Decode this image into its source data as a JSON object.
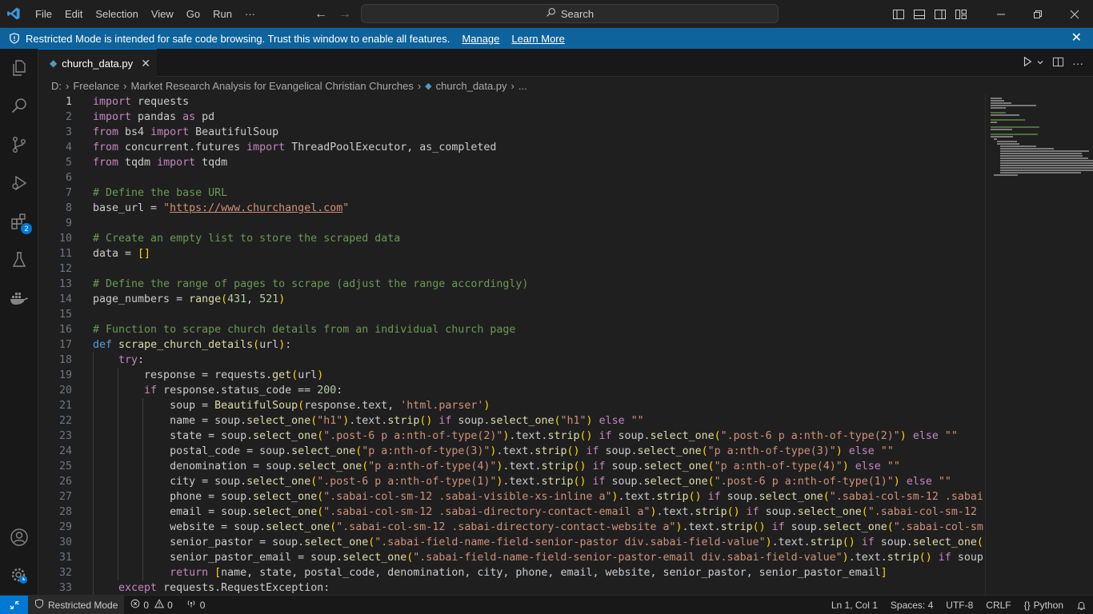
{
  "menu": {
    "items": [
      "File",
      "Edit",
      "Selection",
      "View",
      "Go",
      "Run",
      "···"
    ]
  },
  "search": {
    "label": "Search"
  },
  "banner": {
    "message": "Restricted Mode is intended for safe code browsing. Trust this window to enable all features.",
    "manage": "Manage",
    "learn_more": "Learn More"
  },
  "activity": {
    "extensions_badge": "2"
  },
  "tab": {
    "filename": "church_data.py"
  },
  "breadcrumb": {
    "items": [
      "D:",
      "Freelance",
      "Market Research Analysis for Evangelical Christian Churches",
      "church_data.py",
      "..."
    ]
  },
  "editor": {
    "lines": [
      {
        "n": "1",
        "indent": 0,
        "html": "<span class=\"kw\">import</span> requests"
      },
      {
        "n": "2",
        "indent": 0,
        "html": "<span class=\"kw\">import</span> pandas <span class=\"kw\">as</span> pd"
      },
      {
        "n": "3",
        "indent": 0,
        "html": "<span class=\"kw\">from</span> bs4 <span class=\"kw\">import</span> BeautifulSoup"
      },
      {
        "n": "4",
        "indent": 0,
        "html": "<span class=\"kw\">from</span> concurrent.futures <span class=\"kw\">import</span> ThreadPoolExecutor, as_completed"
      },
      {
        "n": "5",
        "indent": 0,
        "html": "<span class=\"kw\">from</span> tqdm <span class=\"kw\">import</span> tqdm"
      },
      {
        "n": "6",
        "indent": 0,
        "html": ""
      },
      {
        "n": "7",
        "indent": 0,
        "html": "<span class=\"cm\"># Define the base URL</span>"
      },
      {
        "n": "8",
        "indent": 0,
        "html": "base_url = <span class=\"str\">\"</span><span class=\"lnk\">https://www.churchangel.com</span><span class=\"str\">\"</span>"
      },
      {
        "n": "9",
        "indent": 0,
        "html": ""
      },
      {
        "n": "10",
        "indent": 0,
        "html": "<span class=\"cm\"># Create an empty list to store the scraped data</span>"
      },
      {
        "n": "11",
        "indent": 0,
        "html": "data = <span class=\"br1\">[]</span>"
      },
      {
        "n": "12",
        "indent": 0,
        "html": ""
      },
      {
        "n": "13",
        "indent": 0,
        "html": "<span class=\"cm\"># Define the range of pages to scrape (adjust the range accordingly)</span>"
      },
      {
        "n": "14",
        "indent": 0,
        "html": "page_numbers = <span class=\"fn\">range</span><span class=\"br1\">(</span><span class=\"num\">431</span>, <span class=\"num\">521</span><span class=\"br1\">)</span>"
      },
      {
        "n": "15",
        "indent": 0,
        "html": ""
      },
      {
        "n": "16",
        "indent": 0,
        "html": "<span class=\"cm\"># Function to scrape church details from an individual church page</span>"
      },
      {
        "n": "17",
        "indent": 0,
        "html": "<span class=\"kw2\">def</span> <span class=\"fn\">scrape_church_details</span><span class=\"br1\">(</span>url<span class=\"br1\">)</span>:"
      },
      {
        "n": "18",
        "indent": 1,
        "html": "    <span class=\"kw\">try</span>:"
      },
      {
        "n": "19",
        "indent": 2,
        "html": "        response = requests.<span class=\"fn\">get</span><span class=\"br1\">(</span>url<span class=\"br1\">)</span>"
      },
      {
        "n": "20",
        "indent": 2,
        "html": "        <span class=\"kw\">if</span> response.status_code == <span class=\"num\">200</span>:"
      },
      {
        "n": "21",
        "indent": 3,
        "html": "            soup = <span class=\"fn\">BeautifulSoup</span><span class=\"br1\">(</span>response.text, <span class=\"str\">'html.parser'</span><span class=\"br1\">)</span>"
      },
      {
        "n": "22",
        "indent": 3,
        "html": "            name = soup.<span class=\"fn\">select_one</span><span class=\"br1\">(</span><span class=\"str\">\"h1\"</span><span class=\"br1\">)</span>.text.<span class=\"fn\">strip</span><span class=\"br1\">()</span> <span class=\"kw\">if</span> soup.<span class=\"fn\">select_one</span><span class=\"br1\">(</span><span class=\"str\">\"h1\"</span><span class=\"br1\">)</span> <span class=\"kw\">else</span> <span class=\"str\">\"\"</span>"
      },
      {
        "n": "23",
        "indent": 3,
        "html": "            state = soup.<span class=\"fn\">select_one</span><span class=\"br1\">(</span><span class=\"str\">\".post-6 p a:nth-of-type(2)\"</span><span class=\"br1\">)</span>.text.<span class=\"fn\">strip</span><span class=\"br1\">()</span> <span class=\"kw\">if</span> soup.<span class=\"fn\">select_one</span><span class=\"br1\">(</span><span class=\"str\">\".post-6 p a:nth-of-type(2)\"</span><span class=\"br1\">)</span> <span class=\"kw\">else</span> <span class=\"str\">\"\"</span>"
      },
      {
        "n": "24",
        "indent": 3,
        "html": "            postal_code = soup.<span class=\"fn\">select_one</span><span class=\"br1\">(</span><span class=\"str\">\"p a:nth-of-type(3)\"</span><span class=\"br1\">)</span>.text.<span class=\"fn\">strip</span><span class=\"br1\">()</span> <span class=\"kw\">if</span> soup.<span class=\"fn\">select_one</span><span class=\"br1\">(</span><span class=\"str\">\"p a:nth-of-type(3)\"</span><span class=\"br1\">)</span> <span class=\"kw\">else</span> <span class=\"str\">\"\"</span>"
      },
      {
        "n": "25",
        "indent": 3,
        "html": "            denomination = soup.<span class=\"fn\">select_one</span><span class=\"br1\">(</span><span class=\"str\">\"p a:nth-of-type(4)\"</span><span class=\"br1\">)</span>.text.<span class=\"fn\">strip</span><span class=\"br1\">()</span> <span class=\"kw\">if</span> soup.<span class=\"fn\">select_one</span><span class=\"br1\">(</span><span class=\"str\">\"p a:nth-of-type(4)\"</span><span class=\"br1\">)</span> <span class=\"kw\">else</span> <span class=\"str\">\"\"</span>"
      },
      {
        "n": "26",
        "indent": 3,
        "html": "            city = soup.<span class=\"fn\">select_one</span><span class=\"br1\">(</span><span class=\"str\">\".post-6 p a:nth-of-type(1)\"</span><span class=\"br1\">)</span>.text.<span class=\"fn\">strip</span><span class=\"br1\">()</span> <span class=\"kw\">if</span> soup.<span class=\"fn\">select_one</span><span class=\"br1\">(</span><span class=\"str\">\".post-6 p a:nth-of-type(1)\"</span><span class=\"br1\">)</span> <span class=\"kw\">else</span> <span class=\"str\">\"\"</span>"
      },
      {
        "n": "27",
        "indent": 3,
        "html": "            phone = soup.<span class=\"fn\">select_one</span><span class=\"br1\">(</span><span class=\"str\">\".sabai-col-sm-12 .sabai-visible-xs-inline a\"</span><span class=\"br1\">)</span>.text.<span class=\"fn\">strip</span><span class=\"br1\">()</span> <span class=\"kw\">if</span> soup.<span class=\"fn\">select_one</span><span class=\"br1\">(</span><span class=\"str\">\".sabai-col-sm-12 .sabai-visible-xs-inline a\"</span><span class=\"br1\">)</span> <span class=\"kw\">else</span> <span class=\"str\">\"\"</span>"
      },
      {
        "n": "28",
        "indent": 3,
        "html": "            email = soup.<span class=\"fn\">select_one</span><span class=\"br1\">(</span><span class=\"str\">\".sabai-col-sm-12 .sabai-directory-contact-email a\"</span><span class=\"br1\">)</span>.text.<span class=\"fn\">strip</span><span class=\"br1\">()</span> <span class=\"kw\">if</span> soup.<span class=\"fn\">select_one</span><span class=\"br1\">(</span><span class=\"str\">\".sabai-col-sm-12 .sabai-directory-contact-email a\"</span><span class=\"br1\">)</span> <span class=\"kw\">else</span> <span class=\"str\">\"\"</span>"
      },
      {
        "n": "29",
        "indent": 3,
        "html": "            website = soup.<span class=\"fn\">select_one</span><span class=\"br1\">(</span><span class=\"str\">\".sabai-col-sm-12 .sabai-directory-contact-website a\"</span><span class=\"br1\">)</span>.text.<span class=\"fn\">strip</span><span class=\"br1\">()</span> <span class=\"kw\">if</span> soup.<span class=\"fn\">select_one</span><span class=\"br1\">(</span><span class=\"str\">\".sabai-col-sm-12 .sabai-directory-contact-website a\"</span><span class=\"br1\">)</span> <span class=\"kw\">else</span> <span class=\"str\">\"\"</span>"
      },
      {
        "n": "30",
        "indent": 3,
        "html": "            senior_pastor = soup.<span class=\"fn\">select_one</span><span class=\"br1\">(</span><span class=\"str\">\".sabai-field-name-field-senior-pastor div.sabai-field-value\"</span><span class=\"br1\">)</span>.text.<span class=\"fn\">strip</span><span class=\"br1\">()</span> <span class=\"kw\">if</span> soup.<span class=\"fn\">select_one</span><span class=\"br1\">(</span><span class=\"str\">\".sabai-field-name-field-senior-pastor div.sabai-field-value\"</span><span class=\"br1\">)</span> <span class=\"kw\">else</span> <span class=\"str\">\"\"</span>"
      },
      {
        "n": "31",
        "indent": 3,
        "html": "            senior_pastor_email = soup.<span class=\"fn\">select_one</span><span class=\"br1\">(</span><span class=\"str\">\".sabai-field-name-field-senior-pastor-email div.sabai-field-value\"</span><span class=\"br1\">)</span>.text.<span class=\"fn\">strip</span><span class=\"br1\">()</span> <span class=\"kw\">if</span> soup.<span class=\"fn\">select_one</span><span class=\"br1\">(</span><span class=\"str\">\".sabai-field-name-field-senior-pastor-email div.sabai-field-value\"</span><span class=\"br1\">)</span> <span class=\"kw\">else</span> <span class=\"str\">\"\"</span>"
      },
      {
        "n": "32",
        "indent": 3,
        "html": "            <span class=\"kw\">return</span> <span class=\"br1\">[</span>name, state, postal_code, denomination, city, phone, email, website, senior_pastor, senior_pastor_email<span class=\"br1\">]</span>"
      },
      {
        "n": "33",
        "indent": 1,
        "html": "    <span class=\"kw\">except</span> requests.RequestException:"
      }
    ]
  },
  "status": {
    "restricted_mode": "Restricted Mode",
    "errors": "0",
    "warnings": "0",
    "ports": "0",
    "cursor": "Ln 1, Col 1",
    "spaces": "Spaces: 4",
    "encoding": "UTF-8",
    "eol": "CRLF",
    "language": "Python"
  }
}
